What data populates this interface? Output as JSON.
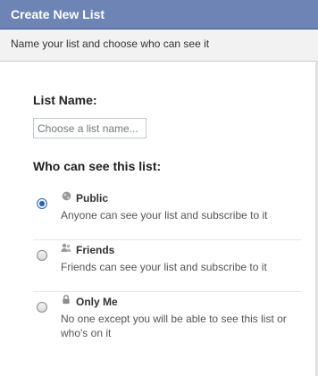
{
  "dialog": {
    "title": "Create New List",
    "subtitle": "Name your list and choose who can see it"
  },
  "form": {
    "name_label": "List Name:",
    "name_placeholder": "Choose a list name...",
    "name_value": "",
    "visibility_label": "Who can see this list:"
  },
  "options": [
    {
      "title": "Public",
      "description": "Anyone can see your list and subscribe to it",
      "icon": "globe-icon",
      "selected": true
    },
    {
      "title": "Friends",
      "description": "Friends can see your list and subscribe to it",
      "icon": "friends-icon",
      "selected": false
    },
    {
      "title": "Only Me",
      "description": "No one except you will be able to see this list or who's on it",
      "icon": "lock-icon",
      "selected": false
    }
  ],
  "colors": {
    "title_bar": "#6d84b4",
    "title_border": "#3b5998",
    "radio_selected": "#2d5ea8"
  }
}
